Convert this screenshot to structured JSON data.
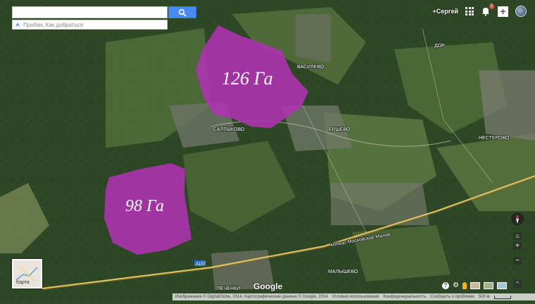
{
  "search": {
    "value": "",
    "suggestion": "Пробки, Как добраться"
  },
  "header": {
    "user": "+Сергей",
    "notifications": "1"
  },
  "map_labels": {
    "area_large": "126 Га",
    "area_small": "98 Га",
    "towns": [
      "ВАСИЛЕВО",
      "САЛТЫКОВО",
      "ЕРШЕВО",
      "НЕСТЕРОВО",
      "ДОР",
      "МАЛЫШЕВО",
      "ПЕЧЕНКИ"
    ],
    "road_name": "кольцо Московское Малое",
    "road_number": "А107"
  },
  "minimap": {
    "label": "Карта"
  },
  "footer": {
    "attribution": "Изображения © DigitalGlobe, 2014, Картографические данные © Google, 2014",
    "terms": "Условия использования",
    "privacy": "Конфиденциальность",
    "report": "Сообщить о проблеме",
    "scale": "500 м"
  },
  "logo": "Google",
  "colors": {
    "area_fill": "#b032b4",
    "road": "#e0c060",
    "search_button": "#4a8af4"
  }
}
